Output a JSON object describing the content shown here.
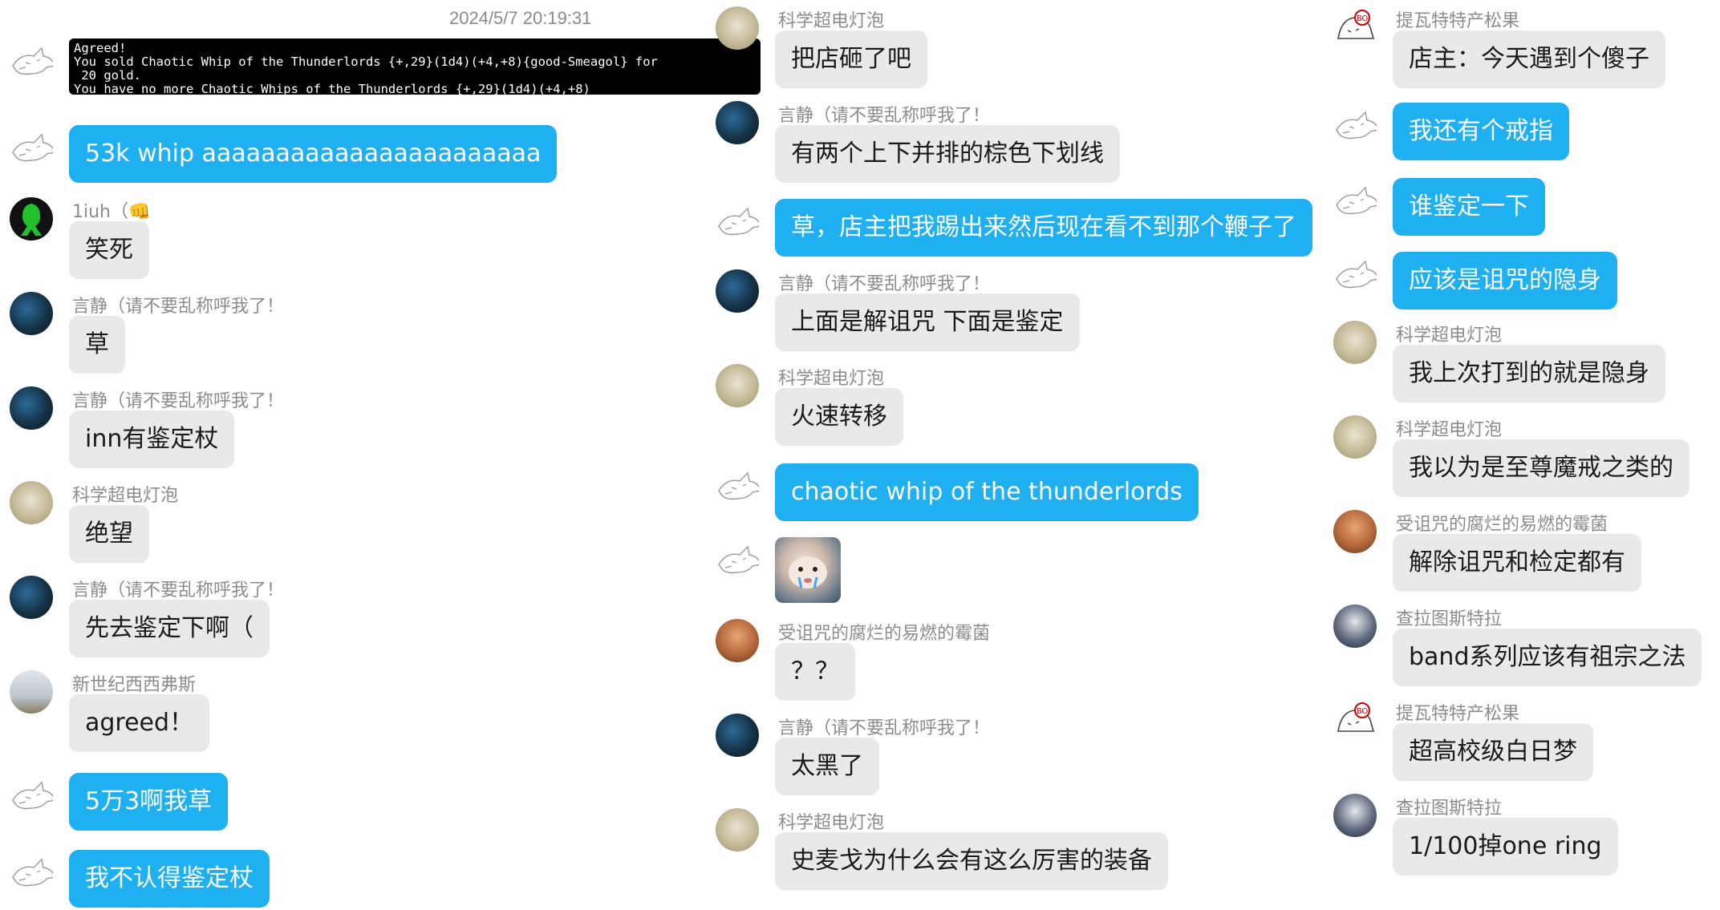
{
  "timestamp": "2024/5/7 20:19:31",
  "colors": {
    "self_bubble": "#1eb0f0",
    "other_bubble": "#e9e9e9",
    "terminal_bg": "#000000"
  },
  "col1": [
    {
      "name": "",
      "avatar": "self-wolf-icon",
      "type": "terminal",
      "text": "Agreed!\nYou sold Chaotic Whip of the Thunderlords {+,29}(1d4)(+4,+8){good-Smeagol} for\n 20 gold.\nYou have no more Chaotic Whips of the Thunderlords {+,29}(1d4)(+4,+8)"
    },
    {
      "name": "",
      "avatar": "self-wolf-icon",
      "type": "self",
      "text": "53k whip aaaaaaaaaaaaaaaaaaaaaaa"
    },
    {
      "name": "1iuh（",
      "emoji": "👊",
      "avatar": "1iuh-avatar",
      "type": "other",
      "text": "笑死"
    },
    {
      "name": "言静（请不要乱称呼我了！",
      "avatar": "yanjing-avatar",
      "type": "other",
      "text": "草"
    },
    {
      "name": "言静（请不要乱称呼我了！",
      "avatar": "yanjing-avatar",
      "type": "other",
      "text": "inn有鉴定杖"
    },
    {
      "name": "科学超电灯泡",
      "avatar": "kexue-avatar",
      "type": "other",
      "text": "绝望"
    },
    {
      "name": "言静（请不要乱称呼我了！",
      "avatar": "yanjing-avatar",
      "type": "other",
      "text": "先去鉴定下啊（"
    },
    {
      "name": "新世纪西西弗斯",
      "avatar": "xinshiji-avatar",
      "type": "other",
      "text": "agreed！"
    },
    {
      "name": "",
      "avatar": "self-wolf-icon",
      "type": "self",
      "text": "5万3啊我草"
    },
    {
      "name": "",
      "avatar": "self-wolf-icon",
      "type": "self",
      "text": "我不认得鉴定杖"
    }
  ],
  "col2": [
    {
      "name": "科学超电灯泡",
      "avatar": "kexue-avatar",
      "type": "other",
      "text": "把店砸了吧"
    },
    {
      "name": "言静（请不要乱称呼我了！",
      "avatar": "yanjing-avatar",
      "type": "other",
      "text": "有两个上下并排的棕色下划线"
    },
    {
      "name": "",
      "avatar": "self-wolf-icon",
      "type": "self",
      "text": "草，店主把我踢出来然后现在看不到那个鞭子了"
    },
    {
      "name": "言静（请不要乱称呼我了！",
      "avatar": "yanjing-avatar",
      "type": "other",
      "text": "上面是解诅咒 下面是鉴定"
    },
    {
      "name": "科学超电灯泡",
      "avatar": "kexue-avatar",
      "type": "other",
      "text": "火速转移"
    },
    {
      "name": "",
      "avatar": "self-wolf-icon",
      "type": "self",
      "text": "chaotic whip of the thunderlords"
    },
    {
      "name": "",
      "avatar": "self-wolf-icon",
      "type": "image",
      "text": ""
    },
    {
      "name": "受诅咒的腐烂的易燃的霉菌",
      "avatar": "shouzu-avatar",
      "type": "other",
      "text": "？？"
    },
    {
      "name": "言静（请不要乱称呼我了！",
      "avatar": "yanjing-avatar",
      "type": "other",
      "text": "太黑了"
    },
    {
      "name": "科学超电灯泡",
      "avatar": "kexue-avatar",
      "type": "other",
      "text": "史麦戈为什么会有这么厉害的装备"
    }
  ],
  "col3": [
    {
      "name": "提瓦特特产松果",
      "avatar": "tiwa-avatar",
      "type": "other",
      "text": "店主：今天遇到个傻子"
    },
    {
      "name": "",
      "avatar": "self-wolf-icon",
      "type": "self",
      "text": "我还有个戒指"
    },
    {
      "name": "",
      "avatar": "self-wolf-icon",
      "type": "self",
      "text": "谁鉴定一下"
    },
    {
      "name": "",
      "avatar": "self-wolf-icon",
      "type": "self",
      "text": "应该是诅咒的隐身"
    },
    {
      "name": "科学超电灯泡",
      "avatar": "kexue-avatar",
      "type": "other",
      "text": "我上次打到的就是隐身"
    },
    {
      "name": "科学超电灯泡",
      "avatar": "kexue-avatar",
      "type": "other",
      "text": "我以为是至尊魔戒之类的"
    },
    {
      "name": "受诅咒的腐烂的易燃的霉菌",
      "avatar": "shouzu-avatar",
      "type": "other",
      "text": "解除诅咒和检定都有"
    },
    {
      "name": "查拉图斯特拉",
      "avatar": "chala-avatar",
      "type": "other",
      "text": "band系列应该有祖宗之法"
    },
    {
      "name": "提瓦特特产松果",
      "avatar": "tiwa-avatar",
      "type": "other",
      "text": "超高校级白日梦"
    },
    {
      "name": "查拉图斯特拉",
      "avatar": "chala-avatar",
      "type": "other",
      "text": "1/100掉one ring"
    }
  ]
}
